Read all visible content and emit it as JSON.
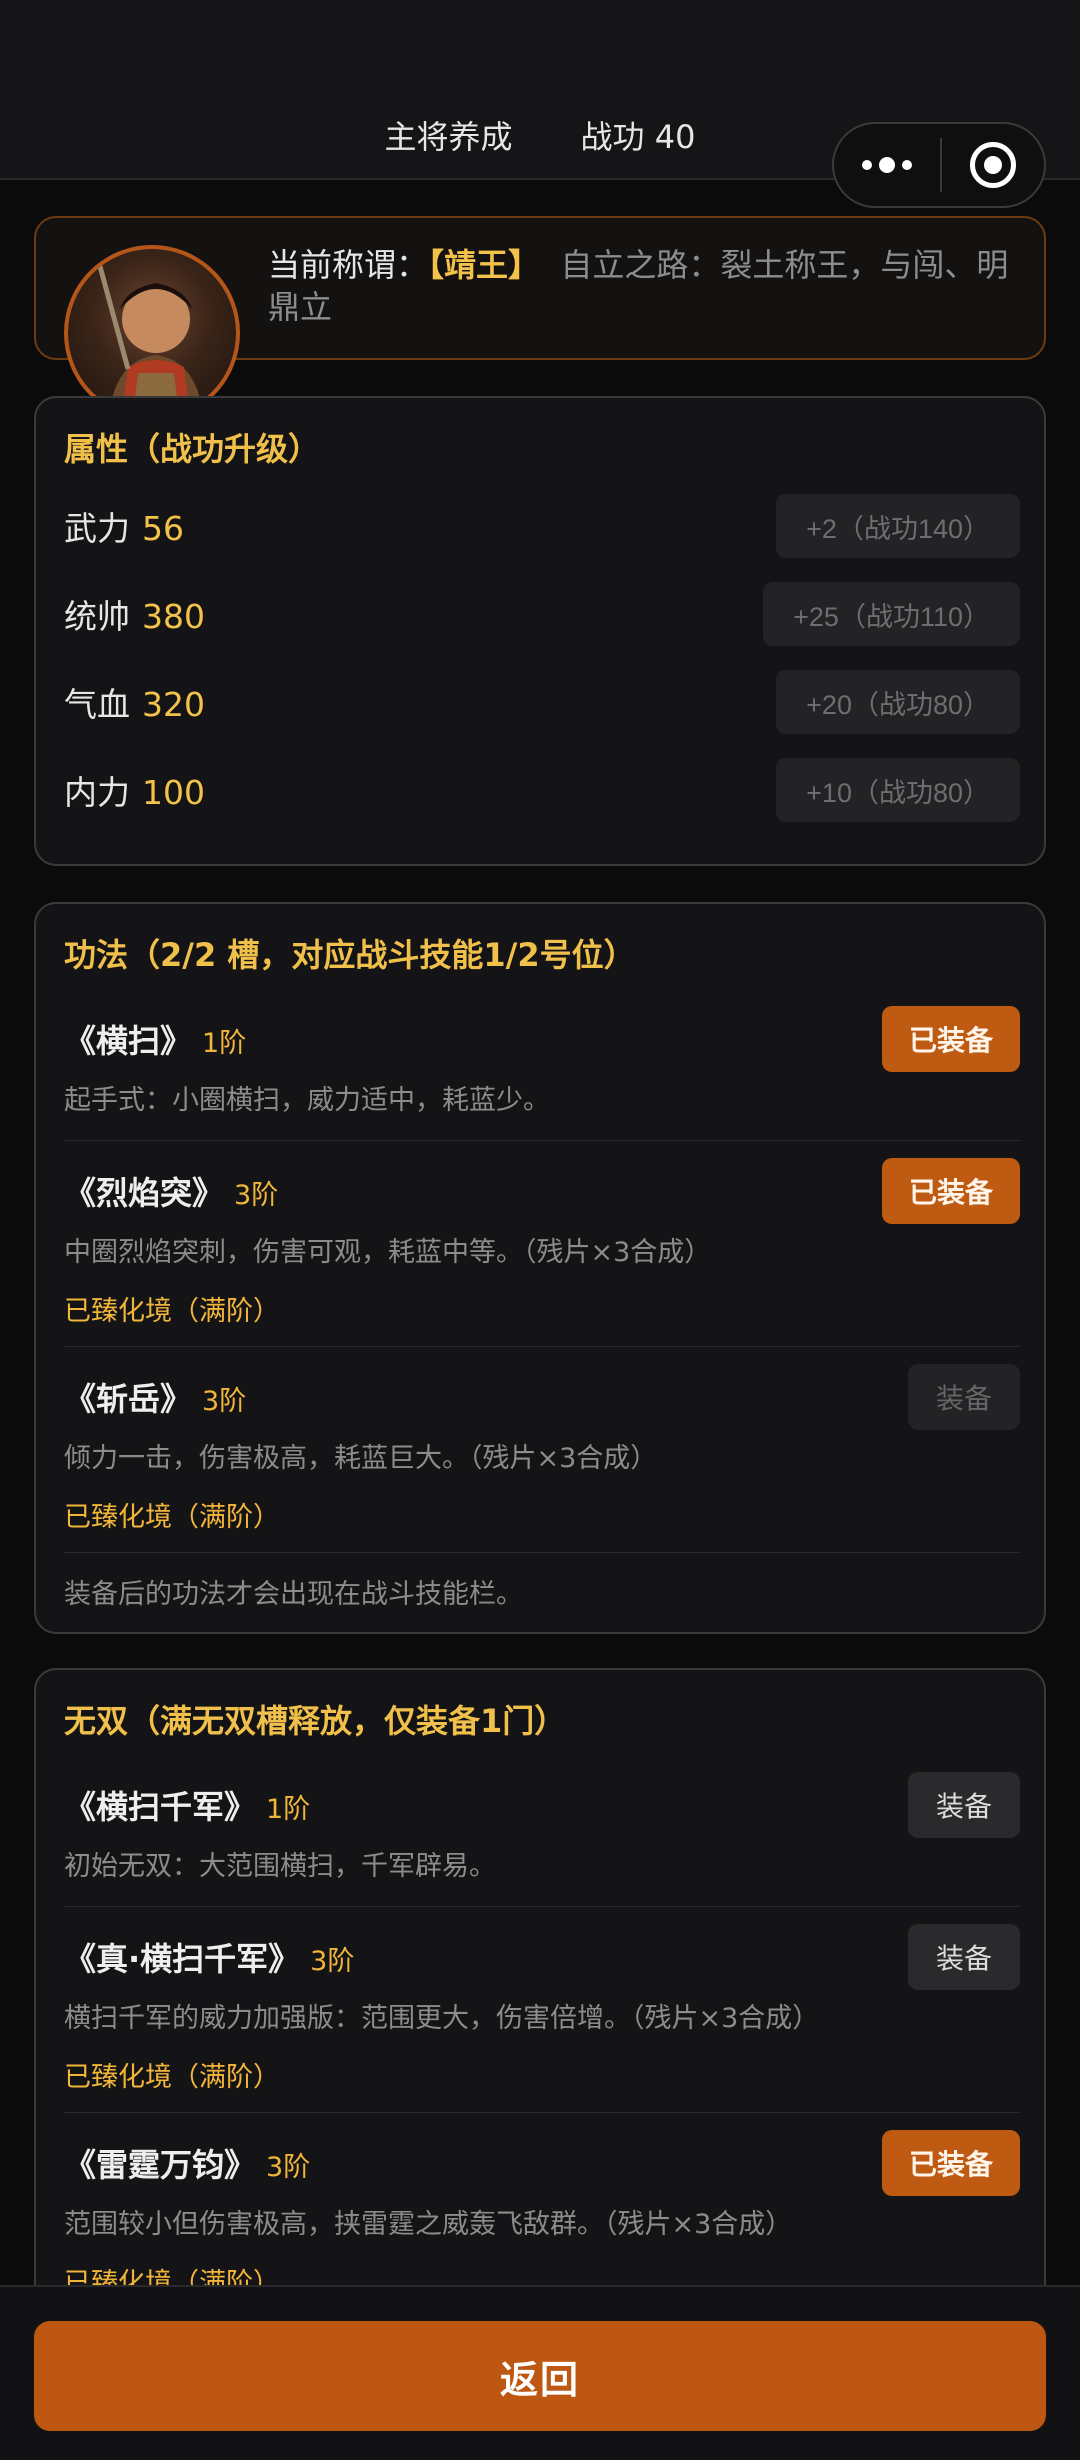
{
  "header": {
    "title": "主将养成",
    "merit": "战功 40"
  },
  "hero": {
    "title_label": "当前称谓：",
    "rank": "【靖王】",
    "path": "自立之路：裂土称王，与闯、明鼎立"
  },
  "attributes": {
    "title": "属性（战功升级）",
    "items": [
      {
        "name": "武力",
        "value": "56",
        "upgrade": "+2（战功140）"
      },
      {
        "name": "统帅",
        "value": "380",
        "upgrade": "+25（战功110）"
      },
      {
        "name": "气血",
        "value": "320",
        "upgrade": "+20（战功80）"
      },
      {
        "name": "内力",
        "value": "100",
        "upgrade": "+10（战功80）"
      }
    ]
  },
  "techniques": {
    "title": "功法（2/2 槽，对应战斗技能1/2号位）",
    "items": [
      {
        "name": "《横扫》",
        "level": "1阶",
        "desc": "起手式：小圈横扫，威力适中，耗蓝少。",
        "button": "已装备"
      },
      {
        "name": "《烈焰突》",
        "level": "3阶",
        "desc": "中圈烈焰突刺，伤害可观，耗蓝中等。（残片×3合成）",
        "max": "已臻化境（满阶）",
        "button": "已装备"
      },
      {
        "name": "《斩岳》",
        "level": "3阶",
        "desc": "倾力一击，伤害极高，耗蓝巨大。（残片×3合成）",
        "max": "已臻化境（满阶）",
        "button": "装备"
      }
    ],
    "note": "装备后的功法才会出现在战斗技能栏。"
  },
  "ultimates": {
    "title": "无双（满无双槽释放，仅装备1门）",
    "items": [
      {
        "name": "《横扫千军》",
        "level": "1阶",
        "desc": "初始无双：大范围横扫，千军辟易。",
        "button": "装备"
      },
      {
        "name": "《真·横扫千军》",
        "level": "3阶",
        "desc": "横扫千军的威力加强版：范围更大，伤害倍增。（残片×3合成）",
        "max": "已臻化境（满阶）",
        "button": "装备"
      },
      {
        "name": "《雷霆万钧》",
        "level": "3阶",
        "desc": "范围较小但伤害极高，挟雷霆之威轰飞敌群。（残片×3合成）",
        "max": "已臻化境（满阶）",
        "button": "已装备"
      }
    ]
  },
  "footer": {
    "back": "返回"
  }
}
